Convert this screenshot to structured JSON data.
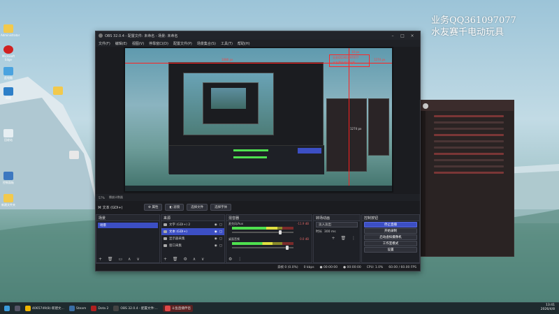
{
  "watermark": {
    "line1": "业务QQ361097077",
    "line2": "水友赛千电动玩具"
  },
  "obs": {
    "title": "OBS 32.0.4 - 配置文件: 未命名 - 场景: 未命名",
    "menu": [
      "文件(F)",
      "编辑(E)",
      "视图(V)",
      "停靠窗口(D)",
      "配置文件(P)",
      "场景集合(S)",
      "工具(T)",
      "帮助(H)"
    ],
    "preview_overlay": {
      "width_label": "1274 px",
      "height_label": "1274 px",
      "left_label": "1080 px",
      "top_label": "10 px",
      "badge_text": "业务QQ361097077",
      "badge_text2": "水友赛千电动玩具"
    },
    "mid_toolbar": {
      "zoom": "57%",
      "label": "播放计数器"
    },
    "source_bar": {
      "current_source": "文本 (GDI+)",
      "buttons": {
        "properties": "属性",
        "filters": "滤镜",
        "select_file": "选择文件",
        "select_font": "选择字体"
      }
    },
    "scenes": {
      "header": "场景",
      "items": [
        "场景"
      ]
    },
    "sources": {
      "header": "来源",
      "items": [
        {
          "name": "文字 (GDI+) 2",
          "selected": false
        },
        {
          "name": "文本 (GDI+)",
          "selected": true
        },
        {
          "name": "显示器采集",
          "selected": false
        },
        {
          "name": "窗口采集",
          "selected": false
        }
      ]
    },
    "mixer": {
      "header": "混音器",
      "channels": [
        {
          "name": "麦克风/Aux",
          "db": "-11.9 dB",
          "level": 0.74,
          "volume": 0.78
        },
        {
          "name": "桌面音频",
          "db": "0.0 dB",
          "level": 0.66,
          "volume": 0.9
        }
      ]
    },
    "transitions": {
      "header": "转场动画",
      "type": "淡入淡出",
      "duration_label": "时长",
      "duration": "300 ms"
    },
    "controls": {
      "header": "控制按钮",
      "buttons": [
        "停止直播",
        "开始录制",
        "启动虚拟摄像机",
        "工作室模式",
        "设置"
      ]
    },
    "status": {
      "frames": "丢帧 0 (0.0%)",
      "bitrate": "0 kbps",
      "live_time": "00:00:00",
      "rec_time": "00:00:00",
      "cpu": "CPU: 1.0%",
      "fps": "60.00 / 60.00 FPS"
    }
  },
  "desktop_icons": [
    "Administrator",
    "Microsoft Edge",
    "此电脑",
    "网络",
    "回收站",
    "控制面板",
    "新建文件夹"
  ],
  "taskbar": {
    "items": [
      {
        "label": "4065749(8)-新建文...",
        "color": "#f0b400"
      },
      {
        "label": "Steam",
        "color": "#3a6ea5"
      },
      {
        "label": "Dota 2",
        "color": "#b02020"
      },
      {
        "label": "OBS 32.0.4 - 配置文件:...",
        "color": "#444"
      },
      {
        "label": "斗鱼直播伴侣",
        "color": "#e04848"
      }
    ],
    "time": "13:41",
    "date": "2026/4/8"
  }
}
